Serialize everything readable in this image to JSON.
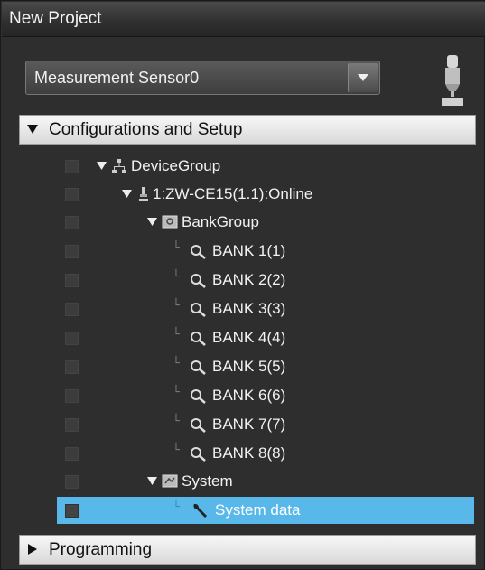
{
  "window": {
    "title": "New Project"
  },
  "device_selector": {
    "value": "Measurement Sensor0",
    "icon": "sensor-device-icon"
  },
  "sections": {
    "configurations": {
      "label": "Configurations and Setup",
      "expanded": true
    },
    "programming": {
      "label": "Programming",
      "expanded": false
    }
  },
  "tree": {
    "device_group": "DeviceGroup",
    "device": "1:ZW-CE15(1.1):Online",
    "bank_group": "BankGroup",
    "banks": [
      "BANK 1(1)",
      "BANK 2(2)",
      "BANK 3(3)",
      "BANK 4(4)",
      "BANK 5(5)",
      "BANK 6(6)",
      "BANK 7(7)",
      "BANK 8(8)"
    ],
    "system": "System",
    "system_data": "System data",
    "selected_item": "System data"
  },
  "colors": {
    "selection": "#58b8ea",
    "background": "#2e2e2e",
    "header": "#e8e8e8"
  }
}
